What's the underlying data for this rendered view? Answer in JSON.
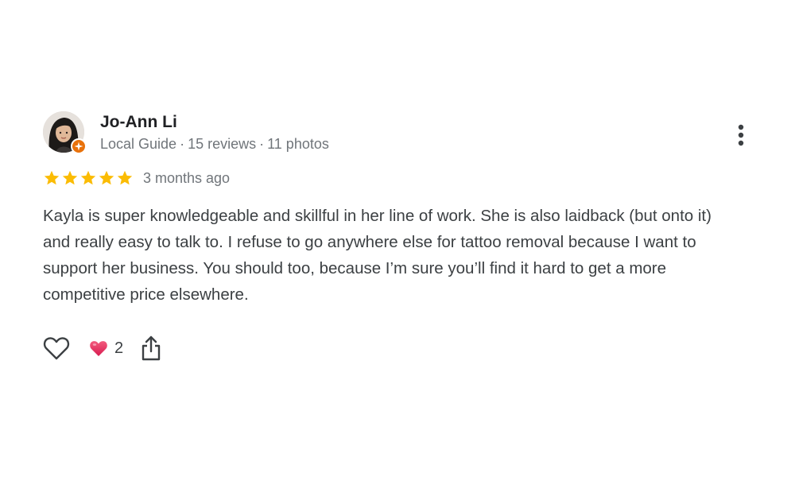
{
  "review": {
    "author": {
      "name": "Jo-Ann Li",
      "badge": "Local Guide",
      "separator": "·",
      "reviews": "15 reviews",
      "photos": "11 photos",
      "avatar_icon": "user-avatar-photo",
      "badge_icon": "local-guide-star-icon"
    },
    "rating": {
      "stars": 5,
      "max_stars": 5,
      "star_color": "#fbbc04",
      "time": "3 months ago"
    },
    "text": "Kayla is super knowledgeable and skillful in her line of work. She is also laidback (but onto it) and really easy to talk to. I refuse to go anywhere else for tattoo removal because I want to support her business. You should too, because I’m sure you’ll find it hard to get a more competitive price elsewhere.",
    "actions": {
      "like_icon": "heart-outline-icon",
      "reaction_icon": "heart-filled-icon",
      "reaction_count": "2",
      "share_icon": "share-icon",
      "more_icon": "more-vert-icon"
    }
  },
  "colors": {
    "guide_badge": "#e8710a",
    "heart_reaction": "#e8335d",
    "muted_text": "#70757a"
  }
}
